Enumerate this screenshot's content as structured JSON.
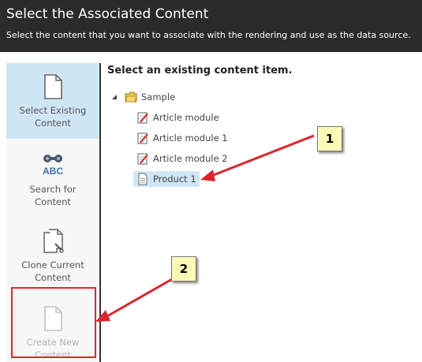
{
  "header": {
    "title": "Select the Associated Content",
    "subtitle": "Select the content that you want to associate with the rendering and use as the data source."
  },
  "sidebar": {
    "items": [
      {
        "label": "Select Existing Content",
        "icon": "document-icon",
        "selected": true
      },
      {
        "label": "Search for Content",
        "icon": "binoculars-abc-icon"
      },
      {
        "label": "Clone Current Content",
        "icon": "clone-document-icon"
      },
      {
        "label": "Create New Content",
        "icon": "new-document-icon",
        "disabled": true
      }
    ]
  },
  "main": {
    "title": "Select an existing content item.",
    "tree": {
      "root": {
        "label": "Sample",
        "icon": "folder-icon",
        "expanded": true
      },
      "children": [
        {
          "label": "Article module",
          "icon": "article-icon"
        },
        {
          "label": "Article module 1",
          "icon": "article-icon"
        },
        {
          "label": "Article module 2",
          "icon": "article-icon"
        },
        {
          "label": "Product 1",
          "icon": "page-icon",
          "selected": true
        }
      ]
    }
  },
  "annotations": {
    "callout_1": "1",
    "callout_2": "2",
    "arrow_color": "#d9262c",
    "highlight_color": "#e8222d",
    "callout_color": "#fdf9b6"
  },
  "colors": {
    "header_bg": "#2b2b2b",
    "selected_bg": "#cfe6f5"
  }
}
